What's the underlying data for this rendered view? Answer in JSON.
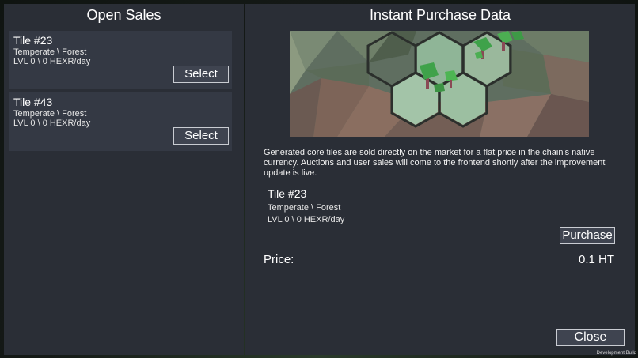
{
  "open_sales": {
    "title": "Open Sales",
    "items": [
      {
        "name": "Tile #23",
        "biome": "Temperate \\ Forest",
        "yield": "LVL 0 \\ 0 HEXR/day",
        "select_label": "Select"
      },
      {
        "name": "Tile #43",
        "biome": "Temperate \\ Forest",
        "yield": "LVL 0 \\ 0 HEXR/day",
        "select_label": "Select"
      }
    ]
  },
  "purchase": {
    "title": "Instant Purchase Data",
    "description": "Generated core tiles are sold directly on the market for a flat price in the chain's native currency. Auctions and user sales will come to the frontend shortly after the improvement update is live.",
    "selected": {
      "name": "Tile #23",
      "biome": "Temperate \\ Forest",
      "yield": "LVL 0 \\ 0 HEXR/day"
    },
    "purchase_label": "Purchase",
    "price_label": "Price:",
    "price_value": "0.1 HT",
    "close_label": "Close"
  },
  "footer": {
    "dev_build": "Development Build"
  },
  "colors": {
    "panel": "#2a2e36",
    "card": "#343944",
    "button": "#3f4450",
    "button_border": "#c9ccd2"
  }
}
